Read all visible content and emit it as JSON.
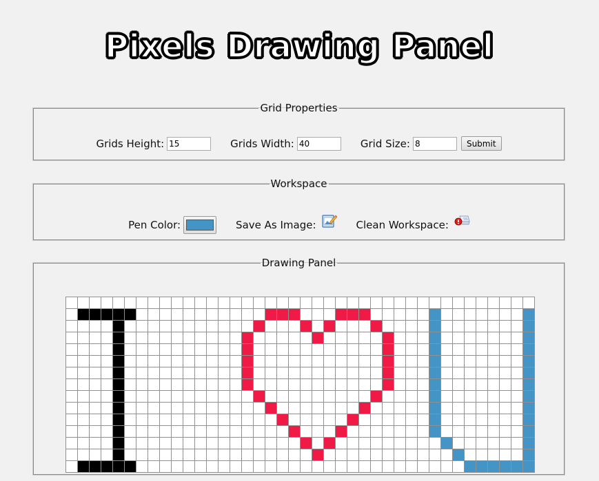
{
  "header": {
    "title": "Pixels Drawing Panel"
  },
  "grid_properties": {
    "legend": "Grid Properties",
    "height_label": "Grids Height:",
    "height_value": "15",
    "width_label": "Grids Width:",
    "width_value": "40",
    "size_label": "Grid Size:",
    "size_value": "8",
    "submit_label": "Submit"
  },
  "workspace": {
    "legend": "Workspace",
    "pen_color_label": "Pen Color:",
    "pen_color": "#4495c6",
    "save_label": "Save As Image:",
    "save_icon": "save-image-icon",
    "clean_label": "Clean Workspace:",
    "clean_icon": "clean-workspace-icon"
  },
  "drawing_panel": {
    "legend": "Drawing Panel",
    "rows": 15,
    "cols": 40,
    "empty_color": "#ffffff",
    "palette": {
      "K": "#000000",
      "R": "#ef1a45",
      "B": "#4495c6"
    },
    "pixels": [
      "........................................",
      ".KKKKK...........RRR...RRR.....B.......B",
      "....K...........R...R.R...R....B.......B",
      "....K..........R.....R.....R...B.......B",
      "....K..........R...........R...B.......B",
      "....K..........R...........R...B.......B",
      "....K..........R...........R...B.......B",
      "....K..........R...........R...B.......B",
      "....K...........R.........R....B.......B",
      "....K............R.......R.....B.......B",
      "....K.............R.....R......B.......B",
      "....K..............R...R.......B.......B",
      "....K...............R.R.........B......B",
      "....K................R...........B.....B",
      ".KKKKK............................BBBBBB"
    ]
  }
}
